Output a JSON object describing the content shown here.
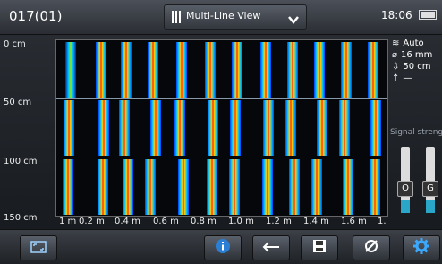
{
  "header": {
    "scan_id": "017(01)",
    "view_mode": "Multi-Line View",
    "time": "18:06"
  },
  "axes": {
    "y_ticks": [
      "0 cm",
      "50 cm",
      "100 cm",
      "150 cm"
    ],
    "x_ticks": [
      "1 m",
      "0.2 m",
      "0.4 m",
      "0.6 m",
      "0.8 m",
      "1.0 m",
      "1.2 m",
      "1.4 m",
      "1.6 m",
      "1."
    ]
  },
  "side_info": {
    "gain": "Auto",
    "diameter": "16 mm",
    "depth": "50 cm",
    "cover": "—"
  },
  "signal": {
    "label": "Signal streng",
    "knob_o": "O",
    "knob_g": "G",
    "o_level": 0.2,
    "g_level": 0.2
  },
  "colors": {
    "accent": "#2aa6c8",
    "rebar_hot": "#ff2a00",
    "rebar_mid": "#ffd200",
    "rebar_edge": "#00c8ff"
  },
  "icons": {
    "fullscreen": "fullscreen-icon",
    "info": "info-icon",
    "back": "back-arrow-icon",
    "save": "save-icon",
    "diameter": "diameter-icon",
    "settings": "gear-icon"
  }
}
